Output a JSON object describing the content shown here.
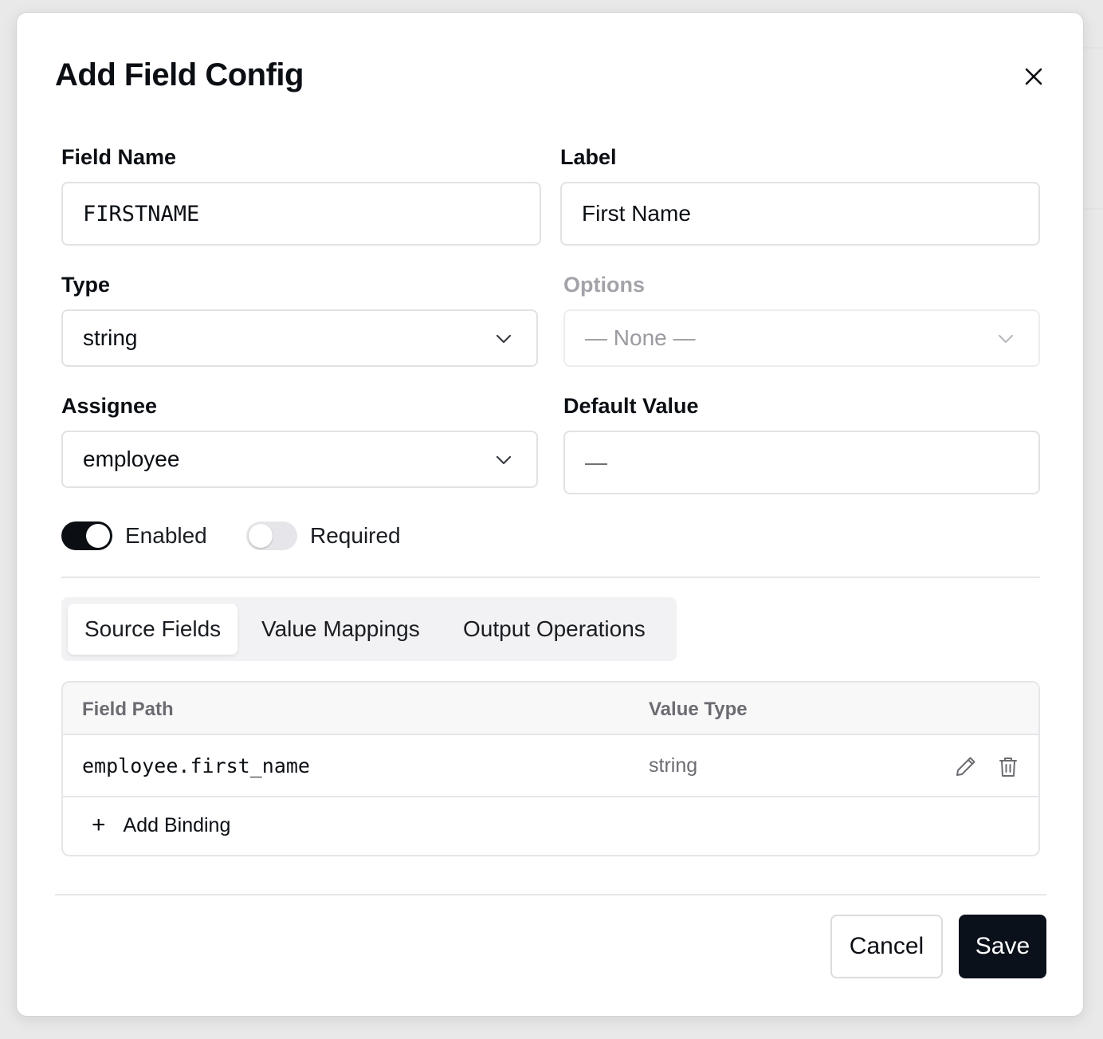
{
  "dialog": {
    "title": "Add Field Config",
    "close_icon": "close-icon"
  },
  "form": {
    "field_name": {
      "label": "Field Name",
      "value": "FIRSTNAME"
    },
    "label_field": {
      "label": "Label",
      "value": "First Name"
    },
    "type": {
      "label": "Type",
      "selected": "string"
    },
    "options": {
      "label": "Options",
      "selected": "— None —",
      "disabled": true
    },
    "assignee": {
      "label": "Assignee",
      "selected": "employee"
    },
    "default_value": {
      "label": "Default Value",
      "value": "—"
    },
    "toggles": {
      "enabled": {
        "label": "Enabled",
        "on": true
      },
      "required": {
        "label": "Required",
        "on": false
      }
    }
  },
  "tabs": [
    {
      "label": "Source Fields",
      "active": true
    },
    {
      "label": "Value Mappings",
      "active": false
    },
    {
      "label": "Output Operations",
      "active": false
    }
  ],
  "table": {
    "columns": [
      "Field Path",
      "Value Type"
    ],
    "rows": [
      {
        "field_path": "employee.first_name",
        "value_type": "string",
        "actions": [
          "pencil-icon",
          "trash-icon"
        ]
      }
    ],
    "add_label": "Add Binding",
    "add_icon": "plus-icon"
  },
  "footer": {
    "cancel_label": "Cancel",
    "save_label": "Save"
  },
  "colors": {
    "primary": "#0b111b",
    "border": "#e2e2e6",
    "muted_text": "#6b6b72"
  }
}
